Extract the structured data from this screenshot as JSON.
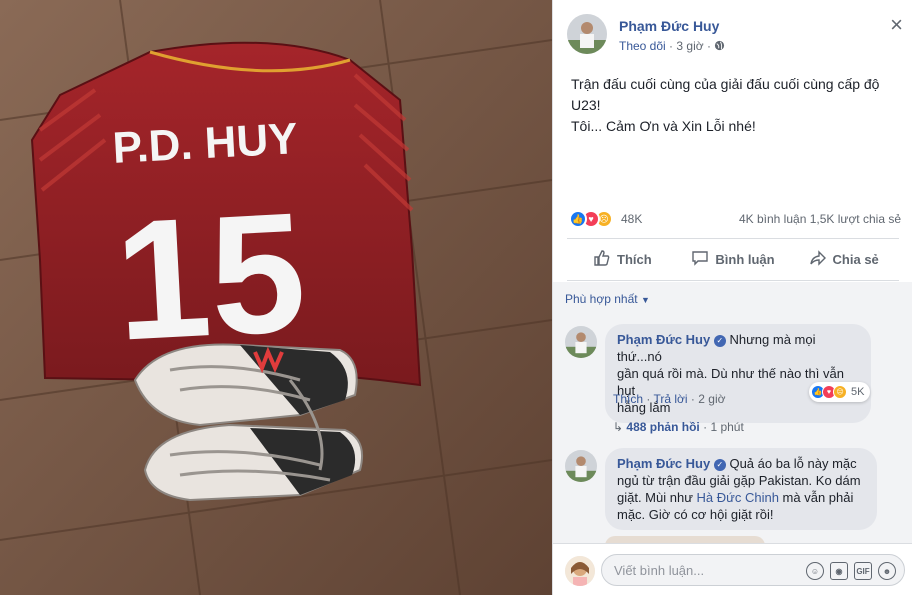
{
  "photo": {
    "jersey_name": "P.D. HUY",
    "jersey_number": "15",
    "jersey_color": "#8c1a1f",
    "floor_color": "#7a5a48"
  },
  "post": {
    "author": "Phạm Đức Huy",
    "follow_label": "Theo dõi",
    "time": "3 giờ",
    "close_icon": "close-icon",
    "caption_lines": [
      "Trận đấu cuối cùng của giải đấu cuối cùng cấp độ",
      "U23!",
      "Tôi... Cảm Ơn và Xin Lỗi nhé!"
    ],
    "reaction_count": "48K",
    "comment_count": "4K bình luận",
    "share_count": "1,5K lượt chia sẻ",
    "actions": {
      "like": "Thích",
      "comment": "Bình luận",
      "share": "Chia sẻ"
    }
  },
  "comments_section": {
    "sort_label": "Phù hợp nhất",
    "comments": [
      {
        "author": "Phạm Đức Huy",
        "text_lines": [
          "Nhưng mà mọi thứ...nó",
          "gần quá rồi mà. Dù như thế nào thì vẫn hụt",
          "hẫng lắm"
        ],
        "like_label": "Thích",
        "reply_label": "Trả lời",
        "time": "2 giờ",
        "reaction_count": "5K",
        "replies": "488 phản hồi",
        "replies_time": "1 phút"
      },
      {
        "author": "Phạm Đức Huy",
        "line1": "Quả áo ba lỗ này mặc",
        "line2": "ngủ từ trận đầu giải gặp Pakistan. Ko dám",
        "line3": "giặt. Mùi như ",
        "mention": "Hà Đức Chinh",
        "line3_end": " mà vẫn phải",
        "line4": "mặc. Giờ có cơ hội giặt rồi!"
      }
    ]
  },
  "composer": {
    "placeholder": "Viết bình luận...",
    "icons": [
      "emoji-icon",
      "camera-icon",
      "gif-icon",
      "sticker-icon"
    ],
    "gif_label": "GIF"
  },
  "colors": {
    "link": "#385898",
    "like_blue": "#1877f2",
    "love_red": "#f33e58",
    "sad_yellow": "#f7b125"
  }
}
